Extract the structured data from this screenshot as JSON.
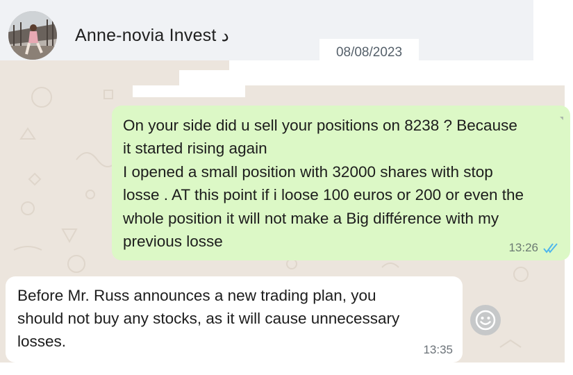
{
  "header": {
    "contact_name": "Anne-novia Invest د",
    "avatar_icon": "profile-photo"
  },
  "date_chip": "08/08/2023",
  "messages": [
    {
      "direction": "outgoing",
      "text": "On your side did u sell your positions on 8238 ? Because\nit started rising again\nI opened a small position with 32000 shares with stop\nlosse . AT this point if i loose 100 euros or 200 or even the\nwhole position it will not make a Big différence with my\nprevious losse",
      "time": "13:26",
      "status_icon": "double-check-read-icon"
    },
    {
      "direction": "incoming",
      "text": "Before Mr. Russ announces a new trading plan, you\nshould not buy any stocks, as it will cause unnecessary\nlosses.",
      "time": "13:35"
    }
  ],
  "emoji_button_icon": "smiley-icon",
  "colors": {
    "outgoing_bubble": "#dcf8c6",
    "incoming_bubble": "#ffffff",
    "chat_background": "#ece5dd",
    "read_ticks": "#4fb6ec"
  }
}
